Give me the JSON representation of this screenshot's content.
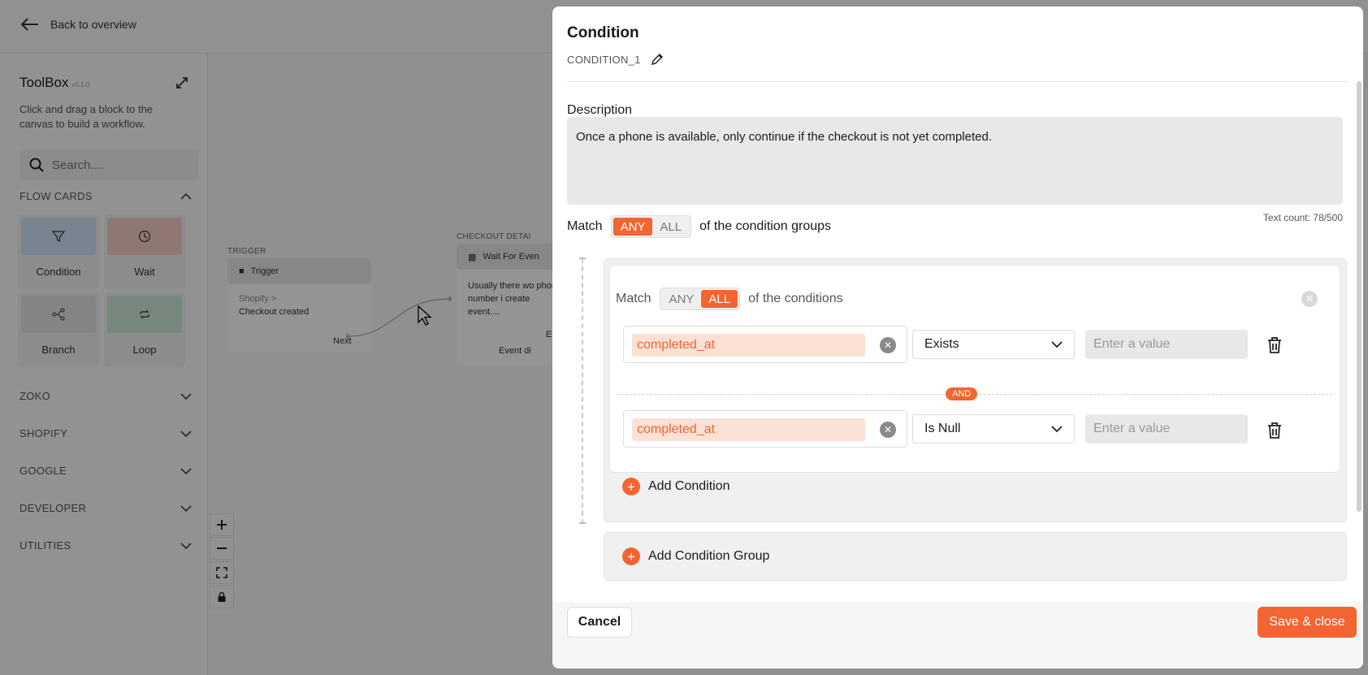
{
  "colors": {
    "accent": "#f26531",
    "accent_light": "#fbe0d6",
    "overlay": "rgba(0,0,0,0.42)"
  },
  "topbar": {
    "back_label": "Back to overview"
  },
  "toolbox": {
    "title": "ToolBox",
    "version": "v0.1.0",
    "description": "Click and drag a block to the canvas to build a workflow.",
    "search_placeholder": "Search....",
    "flow_cards_label": "FLOW CARDS",
    "cards": [
      {
        "label": "Condition",
        "icon": "filter-icon",
        "color": "#cfe3f7"
      },
      {
        "label": "Wait",
        "icon": "clock-icon",
        "color": "#f7cfc6"
      },
      {
        "label": "Branch",
        "icon": "branch-icon",
        "color": "#e3e3e3"
      },
      {
        "label": "Loop",
        "icon": "loop-icon",
        "color": "#cfe8d8"
      }
    ],
    "sections": [
      "ZOKO",
      "SHOPIFY",
      "GOOGLE",
      "DEVELOPER",
      "UTILITIES"
    ]
  },
  "canvas": {
    "trigger_section": "TRIGGER",
    "trigger_title": "Trigger",
    "trigger_source": "Shopify >",
    "trigger_event": "Checkout created",
    "trigger_next": "Next",
    "checkout_section": "CHECKOUT DETAI",
    "wait_title": "Wait For Even",
    "wait_desc": "Usually there wo phone number i create event....",
    "wait_event": "Eve",
    "wait_event2": "Event di"
  },
  "modal": {
    "title": "Condition",
    "id": "CONDITION_1",
    "description_label": "Description",
    "description_value": "Once a phone is available, only continue if the checkout is not yet completed.",
    "text_count": "Text count: 78/500",
    "match_label": "Match",
    "outer_any": "ANY",
    "outer_all": "ALL",
    "outer_suffix": "of the condition groups",
    "group": {
      "match_label": "Match",
      "any": "ANY",
      "all": "ALL",
      "suffix": "of the conditions",
      "conditions": [
        {
          "field": "completed_at",
          "operator": "Exists",
          "value_placeholder": "Enter a value"
        },
        {
          "field": "completed_at",
          "operator": "Is Null",
          "value_placeholder": "Enter a value"
        }
      ],
      "joiner": "AND",
      "add_condition": "Add Condition"
    },
    "add_group": "Add Condition Group",
    "cancel": "Cancel",
    "save": "Save & close"
  }
}
